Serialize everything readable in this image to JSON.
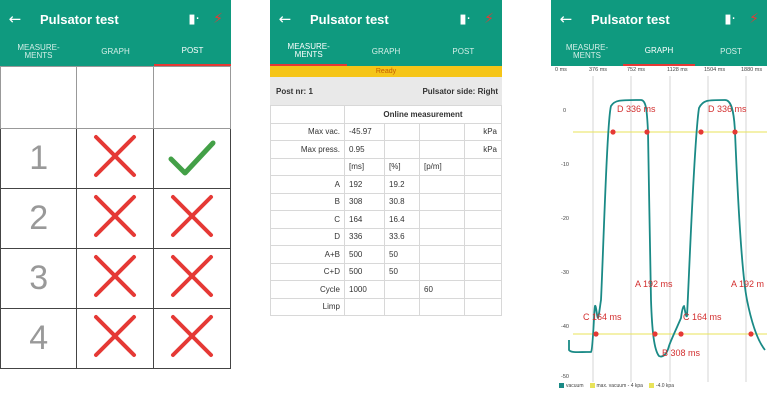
{
  "app": {
    "title": "Pulsator test",
    "back_icon": "arrow-left-icon",
    "bluetooth_icon": "bluetooth-device-icon",
    "power_icon": "lightning-bolt-icon"
  },
  "tabs": [
    {
      "label": "MEASURE-\nMENTS"
    },
    {
      "label": "GRAPH"
    },
    {
      "label": "POST"
    }
  ],
  "colors": {
    "accent": "#0f9a7f",
    "tab_indicator": "#e53935",
    "ready": "#f5c518",
    "curve": "#1a8a86",
    "threshold": "#e8e35a",
    "marker": "#e53935"
  },
  "post_grid": {
    "rows": [
      {
        "number": "1",
        "results": [
          "fail",
          "pass"
        ]
      },
      {
        "number": "2",
        "results": [
          "fail",
          "fail"
        ]
      },
      {
        "number": "3",
        "results": [
          "fail",
          "fail"
        ]
      },
      {
        "number": "4",
        "results": [
          "fail",
          "fail"
        ]
      }
    ]
  },
  "measurements": {
    "status": "Ready",
    "post_nr": "Post nr: 1",
    "pulsator_side": "Pulsator side: Right",
    "section_title": "Online measurement",
    "max_vac": {
      "label": "Max vac.",
      "value": "-45.97",
      "unit": "kPa"
    },
    "max_press": {
      "label": "Max press.",
      "value": "0.95",
      "unit": "kPa"
    },
    "columns": [
      "[ms]",
      "[%]",
      "[p/m]"
    ],
    "rows": [
      {
        "label": "A",
        "ms": "192",
        "pct": "19.2",
        "pm": ""
      },
      {
        "label": "B",
        "ms": "308",
        "pct": "30.8",
        "pm": ""
      },
      {
        "label": "C",
        "ms": "164",
        "pct": "16.4",
        "pm": ""
      },
      {
        "label": "D",
        "ms": "336",
        "pct": "33.6",
        "pm": ""
      },
      {
        "label": "A+B",
        "ms": "500",
        "pct": "50",
        "pm": ""
      },
      {
        "label": "C+D",
        "ms": "500",
        "pct": "50",
        "pm": ""
      },
      {
        "label": "Cycle",
        "ms": "1000",
        "pct": "",
        "pm": "60"
      },
      {
        "label": "Limp",
        "ms": "",
        "pct": "",
        "pm": ""
      }
    ]
  },
  "graph": {
    "x_ticks": [
      "0 ms",
      "376 ms",
      "752 ms",
      "1128 ms",
      "1504 ms",
      "1880 ms"
    ],
    "y_ticks": [
      "0",
      "-10",
      "-20",
      "-30",
      "-40",
      "-50"
    ],
    "phase_labels": [
      "D 336 ms",
      "D 336 ms",
      "A 192 ms",
      "A 192 m",
      "C 164 ms",
      "C 164 ms",
      "B 308 ms"
    ],
    "legend": [
      "vacuum",
      "max. vacuum - 4 kpa",
      "-4.0 kpa"
    ]
  }
}
